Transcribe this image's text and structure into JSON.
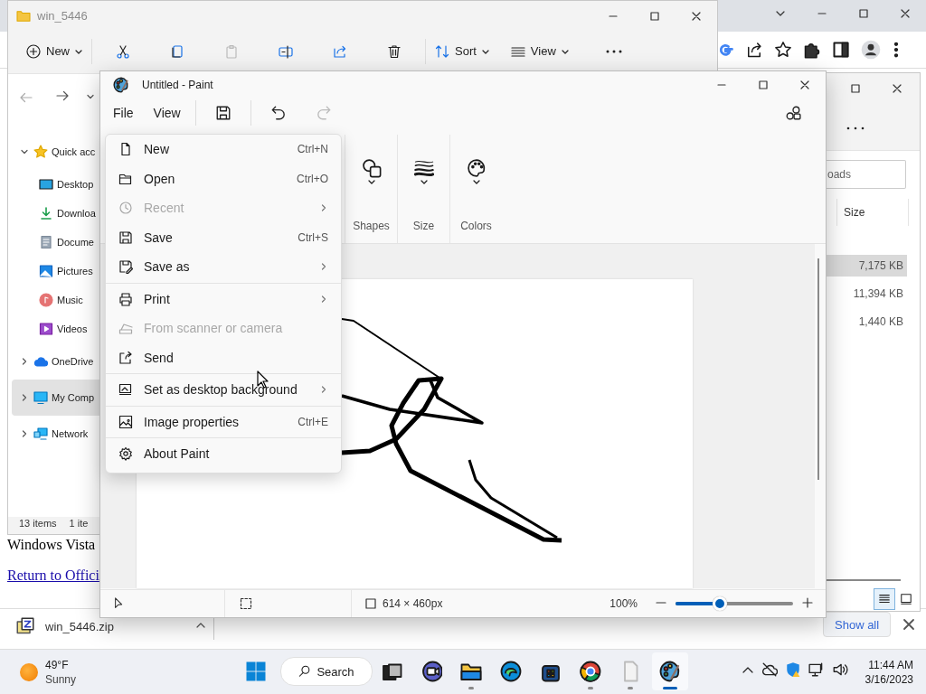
{
  "browser": {
    "page_text": "Windows Vista",
    "page_link": "Return to Offici",
    "download": {
      "file": "win_5446.zip",
      "show_all": "Show all"
    }
  },
  "explorer": {
    "title": "win_5446",
    "toolbar": {
      "new": "New",
      "sort": "Sort",
      "view": "View",
      "paste_disabled": true
    },
    "nav": [
      {
        "label": "Quick acc",
        "expanded": true,
        "selected": false,
        "children": [
          {
            "label": "Desktop",
            "selected": false
          },
          {
            "label": "Downloa",
            "selected": false
          },
          {
            "label": "Docume",
            "selected": false
          },
          {
            "label": "Pictures",
            "selected": false
          },
          {
            "label": "Music",
            "selected": false
          },
          {
            "label": "Videos",
            "selected": false
          }
        ]
      },
      {
        "label": "OneDrive",
        "expanded": false,
        "selected": false
      },
      {
        "label": "My Comp",
        "expanded": false,
        "selected": true
      },
      {
        "label": "Network",
        "expanded": false,
        "selected": false
      }
    ],
    "status": [
      "13 items",
      "1 ite"
    ]
  },
  "downloads_window": {
    "search": {
      "placeholder": "oads"
    },
    "column": "Size",
    "rows": [
      {
        "size": "7,175 KB",
        "selected": true
      },
      {
        "size": "11,394 KB",
        "selected": false
      },
      {
        "size": "1,440 KB",
        "selected": false
      }
    ],
    "view_buttons": [
      {
        "selected": true
      },
      {
        "selected": false
      }
    ]
  },
  "paint": {
    "title": "Untitled - Paint",
    "menus": [
      "File",
      "View"
    ],
    "redo_disabled": true,
    "ribbon": [
      "Shapes",
      "Size",
      "Colors"
    ],
    "canvas_size": "614 × 460px",
    "zoom": "100%",
    "zoom_slider": {
      "level": 0.38
    }
  },
  "file_menu": [
    [
      {
        "label": "New",
        "shortcut": "Ctrl+N",
        "disabled": false,
        "submenu": false
      },
      {
        "label": "Open",
        "shortcut": "Ctrl+O",
        "disabled": false,
        "submenu": false
      },
      {
        "label": "Recent",
        "disabled": true,
        "submenu": true
      },
      {
        "label": "Save",
        "shortcut": "Ctrl+S",
        "disabled": false,
        "submenu": false
      },
      {
        "label": "Save as",
        "disabled": false,
        "submenu": true
      }
    ],
    [
      {
        "label": "Print",
        "disabled": false,
        "submenu": true
      },
      {
        "label": "From scanner or camera",
        "disabled": true,
        "submenu": false
      },
      {
        "label": "Send",
        "disabled": false,
        "submenu": false
      }
    ],
    [
      {
        "label": "Set as desktop background",
        "disabled": false,
        "submenu": true
      }
    ],
    [
      {
        "label": "Image properties",
        "shortcut": "Ctrl+E",
        "disabled": false,
        "submenu": false
      }
    ],
    [
      {
        "label": "About Paint",
        "disabled": false,
        "submenu": false
      }
    ]
  ],
  "taskbar": {
    "weather": {
      "temp": "49°F",
      "condition": "Sunny"
    },
    "search": "Search",
    "apps": [
      {
        "running": false,
        "selected": false
      },
      {
        "running": false,
        "selected": false
      },
      {
        "running": true,
        "selected": false
      },
      {
        "running": false,
        "selected": false
      },
      {
        "running": false,
        "selected": false
      },
      {
        "running": true,
        "selected": false
      },
      {
        "running": true,
        "selected": false
      },
      {
        "running": true,
        "selected": true
      }
    ],
    "time": "11:44 AM",
    "date": "3/16/2023"
  }
}
